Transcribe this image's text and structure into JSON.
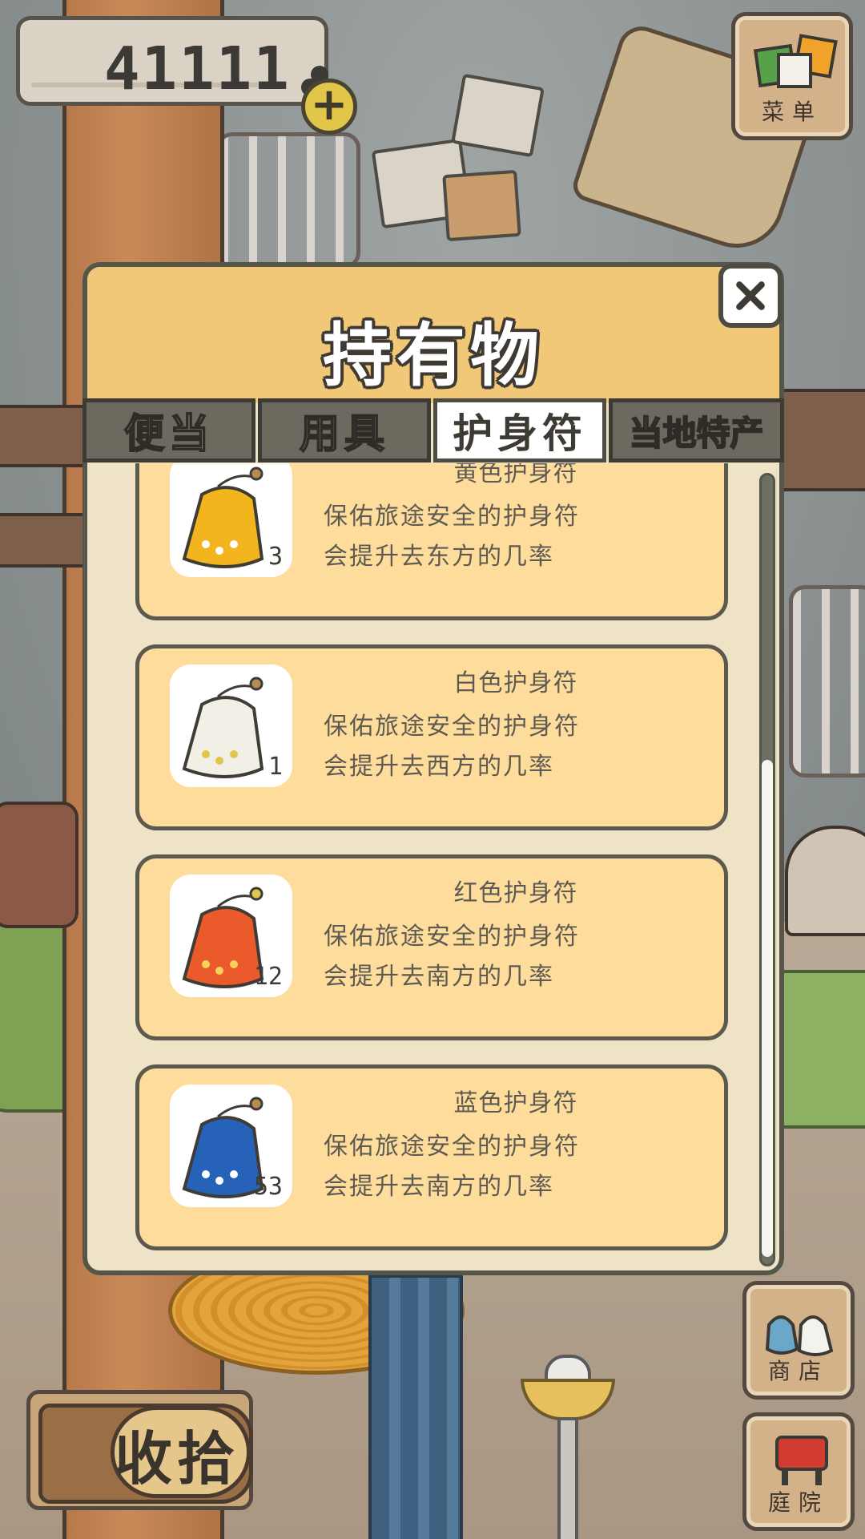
{
  "hud": {
    "clover_count": "41111",
    "add_clover_label": "+",
    "menu_label": "菜单",
    "shop_label": "商店",
    "garden_label": "庭院",
    "collect_label": "收拾"
  },
  "panel": {
    "title": "持有物",
    "close_label": "✕",
    "tabs": [
      {
        "label": "便当"
      },
      {
        "label": "用具"
      },
      {
        "label": "护身符"
      },
      {
        "label": "当地特产"
      }
    ],
    "active_tab": "护身符",
    "items": [
      {
        "name": "黄色护身符",
        "line1": "保佑旅途安全的护身符",
        "line2": "会提升去东方的几率",
        "count": "3",
        "color": "#f2b51e"
      },
      {
        "name": "白色护身符",
        "line1": "保佑旅途安全的护身符",
        "line2": "会提升去西方的几率",
        "count": "1",
        "color": "#f2efe6"
      },
      {
        "name": "红色护身符",
        "line1": "保佑旅途安全的护身符",
        "line2": "会提升去南方的几率",
        "count": "12",
        "color": "#ea5a2a"
      },
      {
        "name": "蓝色护身符",
        "line1": "保佑旅途安全的护身符",
        "line2": "会提升去南方的几率",
        "count": "53",
        "color": "#2662b8"
      }
    ]
  },
  "colors": {
    "panel_header": "#f1c778",
    "card_bg": "#fedd9c",
    "panel_bg": "#eee3c7"
  }
}
